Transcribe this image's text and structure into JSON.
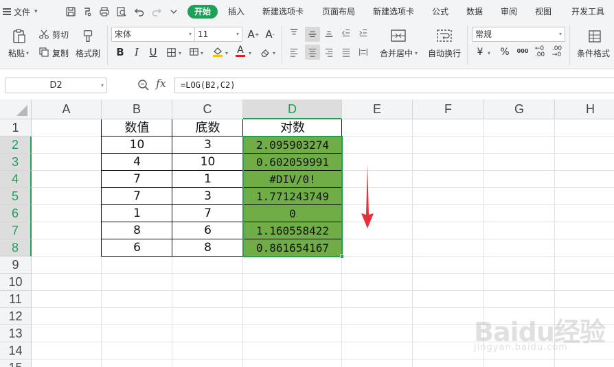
{
  "menubar": {
    "file_label": "文件",
    "tabs": [
      {
        "label": "开始",
        "active": true
      },
      {
        "label": "插入",
        "active": false
      },
      {
        "label": "新建选项卡",
        "active": false
      },
      {
        "label": "页面布局",
        "active": false
      },
      {
        "label": "新建选项卡",
        "active": false
      },
      {
        "label": "公式",
        "active": false
      },
      {
        "label": "数据",
        "active": false
      },
      {
        "label": "审阅",
        "active": false
      },
      {
        "label": "视图",
        "active": false
      },
      {
        "label": "开发工具",
        "active": false
      }
    ]
  },
  "ribbon": {
    "paste_label": "粘贴",
    "cut_label": "剪切",
    "copy_label": "复制",
    "format_painter_label": "格式刷",
    "font_name": "宋体",
    "font_size": "11",
    "number_format": "常规",
    "merge_center_label": "合并居中",
    "wrap_text_label": "自动换行",
    "conditional_format_label": "条件格式",
    "currency_symbol": "¥",
    "percent_symbol": "%",
    "thousands_symbol": "000",
    "font_color": "#e02020",
    "fill_color": "#f5c400"
  },
  "formula_bar": {
    "cell_ref": "D2",
    "fx_label": "fx",
    "formula": "=LOG(B2,C2)"
  },
  "sheet": {
    "columns": [
      "A",
      "B",
      "C",
      "D",
      "E",
      "F",
      "G",
      "H"
    ],
    "selected_column": "D",
    "rows": [
      "1",
      "2",
      "3",
      "4",
      "5",
      "6",
      "7",
      "8",
      "9",
      "10",
      "11",
      "12",
      "13",
      "14",
      "15"
    ],
    "selected_rows": [
      "2",
      "3",
      "4",
      "5",
      "6",
      "7",
      "8"
    ],
    "headers": {
      "B": "数值",
      "C": "底数",
      "D": "对数"
    },
    "data": [
      {
        "b": "10",
        "c": "3",
        "d": "2.095903274"
      },
      {
        "b": "4",
        "c": "10",
        "d": "0.602059991"
      },
      {
        "b": "7",
        "c": "1",
        "d": "#DIV/0!"
      },
      {
        "b": "7",
        "c": "3",
        "d": "1.771243749"
      },
      {
        "b": "1",
        "c": "7",
        "d": "0"
      },
      {
        "b": "8",
        "c": "6",
        "d": "1.160558422"
      },
      {
        "b": "6",
        "c": "8",
        "d": "0.861654167"
      }
    ],
    "accent_color": "#1fa057",
    "result_fill_color": "#71ad47"
  },
  "watermark": {
    "brand": "Baidu经验",
    "url": "jingyan.baidu.com"
  }
}
